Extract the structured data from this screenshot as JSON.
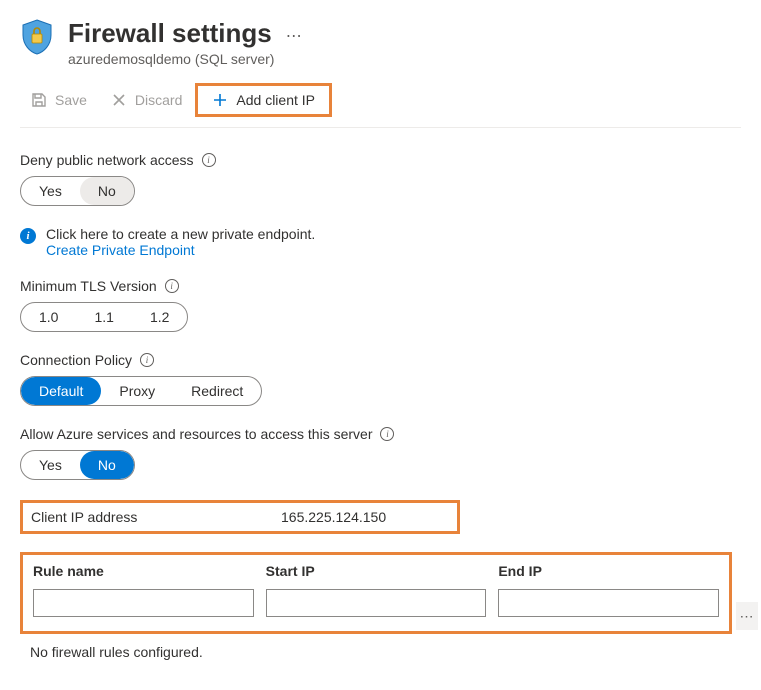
{
  "header": {
    "title": "Firewall settings",
    "subtitle": "azuredemosqldemo (SQL server)"
  },
  "toolbar": {
    "save": "Save",
    "discard": "Discard",
    "add_client_ip": "Add client IP"
  },
  "deny_access": {
    "label": "Deny public network access",
    "yes": "Yes",
    "no": "No"
  },
  "private_endpoint": {
    "text": "Click here to create a new private endpoint.",
    "link": "Create Private Endpoint"
  },
  "tls": {
    "label": "Minimum TLS Version",
    "v10": "1.0",
    "v11": "1.1",
    "v12": "1.2"
  },
  "policy": {
    "label": "Connection Policy",
    "default": "Default",
    "proxy": "Proxy",
    "redirect": "Redirect"
  },
  "allow_azure": {
    "label": "Allow Azure services and resources to access this server",
    "yes": "Yes",
    "no": "No"
  },
  "client_ip": {
    "label": "Client IP address",
    "value": "165.225.124.150"
  },
  "table": {
    "col_rule": "Rule name",
    "col_start": "Start IP",
    "col_end": "End IP",
    "empty": "No firewall rules configured."
  }
}
